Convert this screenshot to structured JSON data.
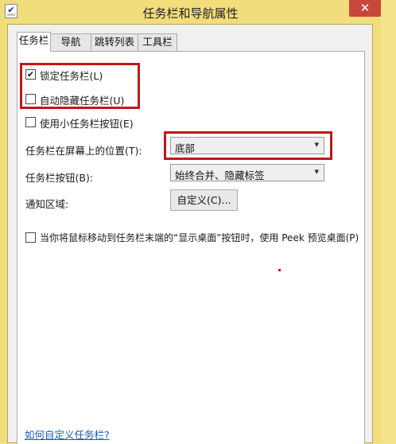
{
  "window": {
    "title": "任务栏和导航属性",
    "close_glyph": "✕",
    "app_icon_glyph": "✔"
  },
  "tabs": [
    {
      "label": "任务栏",
      "active": true
    },
    {
      "label": "导航",
      "active": false
    },
    {
      "label": "跳转列表",
      "active": false
    },
    {
      "label": "工具栏",
      "active": false
    }
  ],
  "options": {
    "lock_taskbar": {
      "label": "锁定任务栏(L)",
      "checked": true,
      "check_glyph": "✔"
    },
    "auto_hide": {
      "label": "自动隐藏任务栏(U)",
      "checked": false
    },
    "small_buttons": {
      "label": "使用小任务栏按钮(E)",
      "checked": false
    },
    "peek": {
      "label": "当你将鼠标移动到任务栏末端的“显示桌面”按钮时，使用 Peek 预览桌面(P)",
      "checked": false
    }
  },
  "position": {
    "label": "任务栏在屏幕上的位置(T):",
    "value": "底部"
  },
  "buttons_setting": {
    "label": "任务栏按钮(B):",
    "value": "始终合并、隐藏标签"
  },
  "notification": {
    "label": "通知区域:",
    "button_label": "自定义(C)..."
  },
  "help_link": "如何自定义任务栏?",
  "colors": {
    "highlight": "#c0171b",
    "link": "#1a5fb4",
    "close": "#c7483b"
  },
  "icons": {
    "chevron": "▾"
  }
}
